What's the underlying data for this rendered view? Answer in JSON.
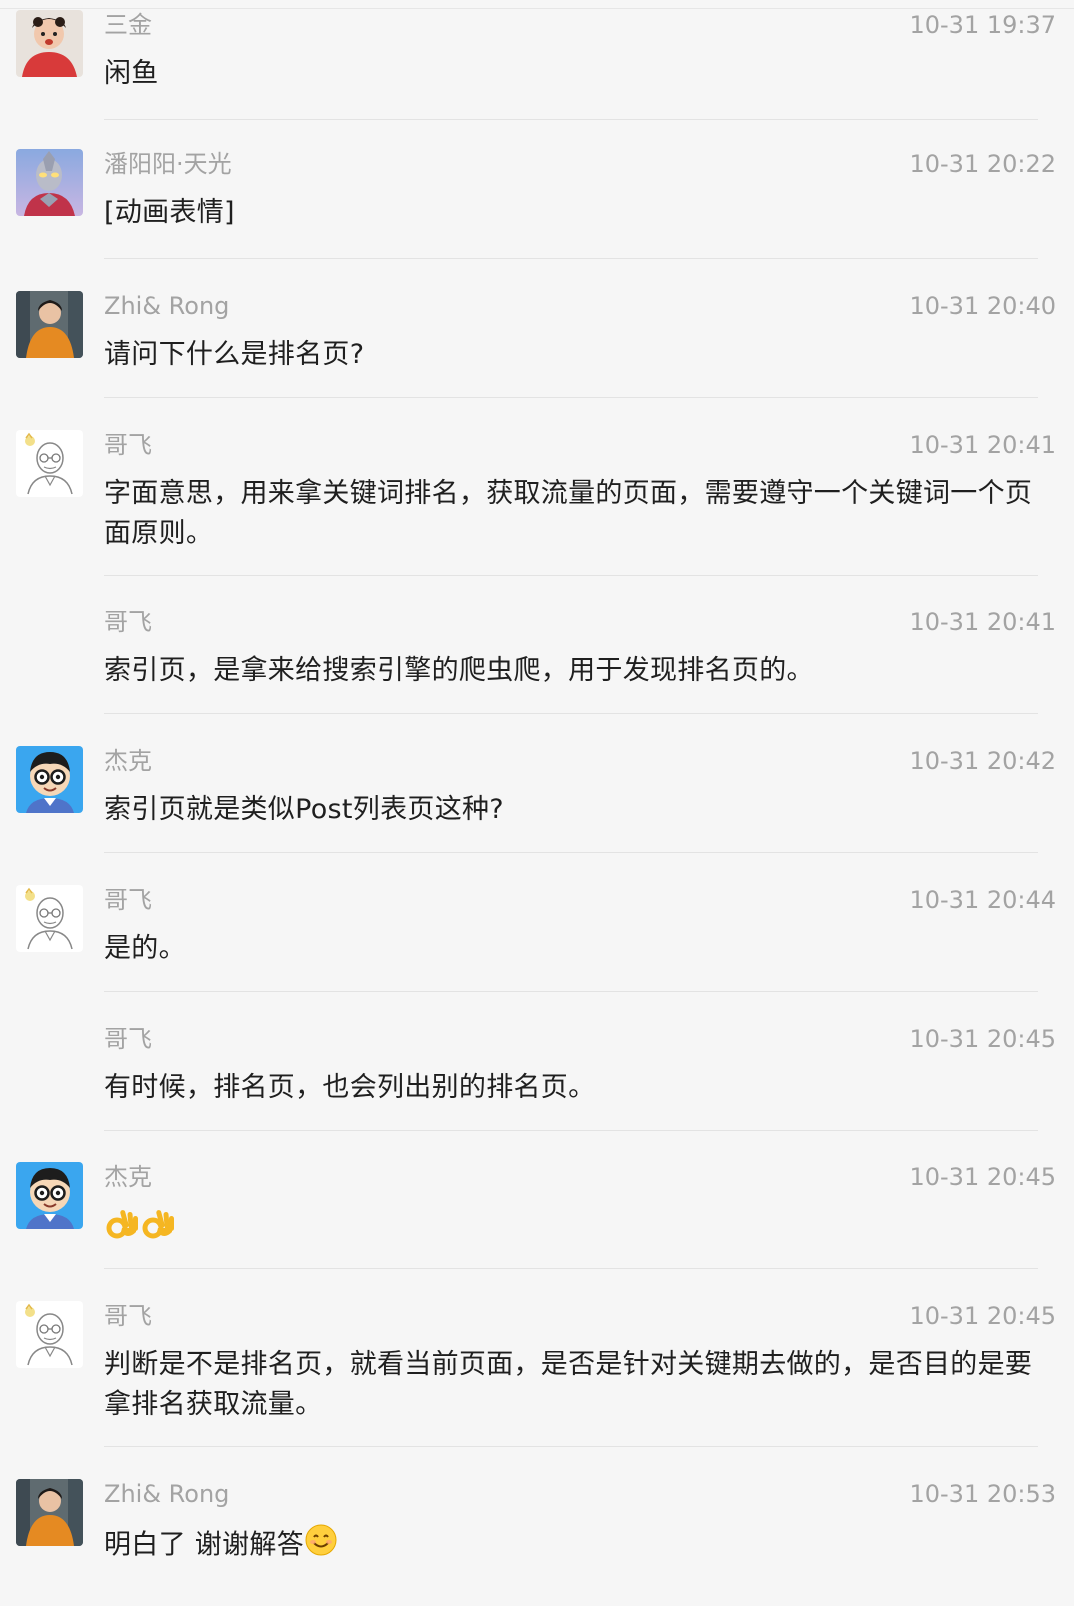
{
  "messages": [
    {
      "name": "三金",
      "time": "10-31 19:37",
      "text": "闲鱼",
      "avatar": "avatar-girl-red"
    },
    {
      "name": "潘阳阳·天光",
      "time": "10-31 20:22",
      "text": "[动画表情]",
      "avatar": "avatar-ultraman"
    },
    {
      "name": "Zhi& Rong",
      "time": "10-31 20:40",
      "text": "请问下什么是排名页?",
      "avatar": "avatar-woman-orange"
    },
    {
      "name": "哥飞",
      "time": "10-31 20:41",
      "text": "字面意思，用来拿关键词排名，获取流量的页面，需要遵守一个关键词一个页面原则。",
      "avatar": "avatar-sketch-man"
    },
    {
      "name": "哥飞",
      "time": "10-31 20:41",
      "text": "索引页，是拿来给搜索引擎的爬虫爬，用于发现排名页的。",
      "avatar": ""
    },
    {
      "name": "杰克",
      "time": "10-31 20:42",
      "text": "索引页就是类似Post列表页这种?",
      "avatar": "avatar-cartoon-glasses"
    },
    {
      "name": "哥飞",
      "time": "10-31 20:44",
      "text": "是的。",
      "avatar": "avatar-sketch-man"
    },
    {
      "name": "哥飞",
      "time": "10-31 20:45",
      "text": "有时候，排名页，也会列出别的排名页。",
      "avatar": ""
    },
    {
      "name": "杰克",
      "time": "10-31 20:45",
      "text": "",
      "emojis": [
        "ok-hand-emoji",
        "ok-hand-emoji"
      ],
      "avatar": "avatar-cartoon-glasses"
    },
    {
      "name": "哥飞",
      "time": "10-31 20:45",
      "text": "判断是不是排名页，就看当前页面，是否是针对关键期去做的，是否目的是要拿排名获取流量。",
      "avatar": "avatar-sketch-man"
    },
    {
      "name": "Zhi& Rong",
      "time": "10-31 20:53",
      "text": "明白了 谢谢解答",
      "emojis": [
        "smile-emoji"
      ],
      "avatar": "avatar-woman-orange"
    }
  ]
}
